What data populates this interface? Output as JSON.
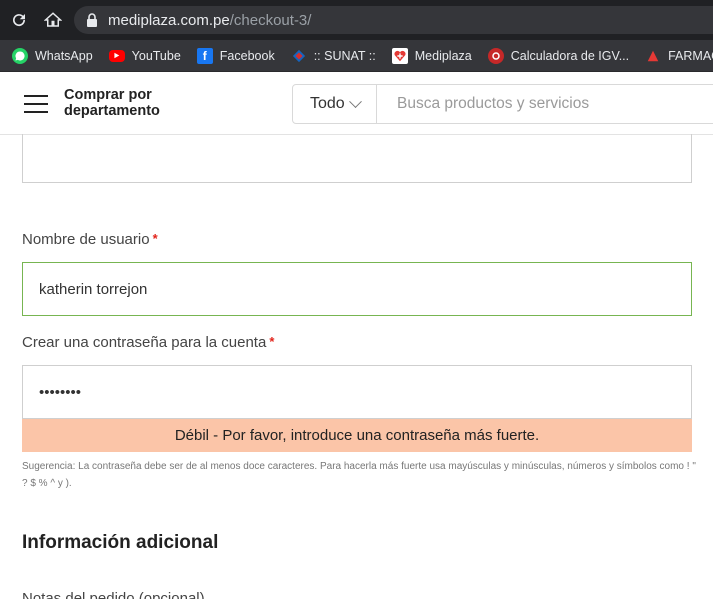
{
  "browser": {
    "url_host": "mediplaza.com.pe",
    "url_path": "/checkout-3/",
    "bookmarks": [
      {
        "label": "WhatsApp",
        "icon": "whatsapp-icon",
        "color": "#25d366"
      },
      {
        "label": "YouTube",
        "icon": "youtube-icon",
        "color": "#ff0000"
      },
      {
        "label": "Facebook",
        "icon": "facebook-icon",
        "color": "#1877f2"
      },
      {
        "label": ":: SUNAT ::",
        "icon": "sunat-icon",
        "color": "#d32f2f"
      },
      {
        "label": "Mediplaza",
        "icon": "mediplaza-icon",
        "color": "#e53935"
      },
      {
        "label": "Calculadora de IGV...",
        "icon": "calculator-icon",
        "color": "#c62828"
      },
      {
        "label": "FARMACIA",
        "icon": "pharmacy-icon",
        "color": "#e53935"
      }
    ]
  },
  "header": {
    "dept_label": "Comprar por departamento",
    "search_category": "Todo",
    "search_placeholder": "Busca productos y servicios"
  },
  "form": {
    "username_label": "Nombre de usuario",
    "username_value": "katherin torrejon",
    "password_label": "Crear una contraseña para la cuenta",
    "password_value": "12345678",
    "required_mark": "*",
    "strength_message": "Débil - Por favor, introduce una contraseña más fuerte.",
    "hint": "Sugerencia: La contraseña debe ser de al menos doce caracteres. Para hacerla más fuerte usa mayúsculas y minúsculas, números y símbolos como ! \" ? $ % ^ y )."
  },
  "additional": {
    "title": "Información adicional",
    "next_label": "Notas del pedido (opcional)"
  },
  "colors": {
    "valid_border": "#77b551",
    "weak_bg": "#fbc5a8",
    "required": "#e2231a"
  }
}
